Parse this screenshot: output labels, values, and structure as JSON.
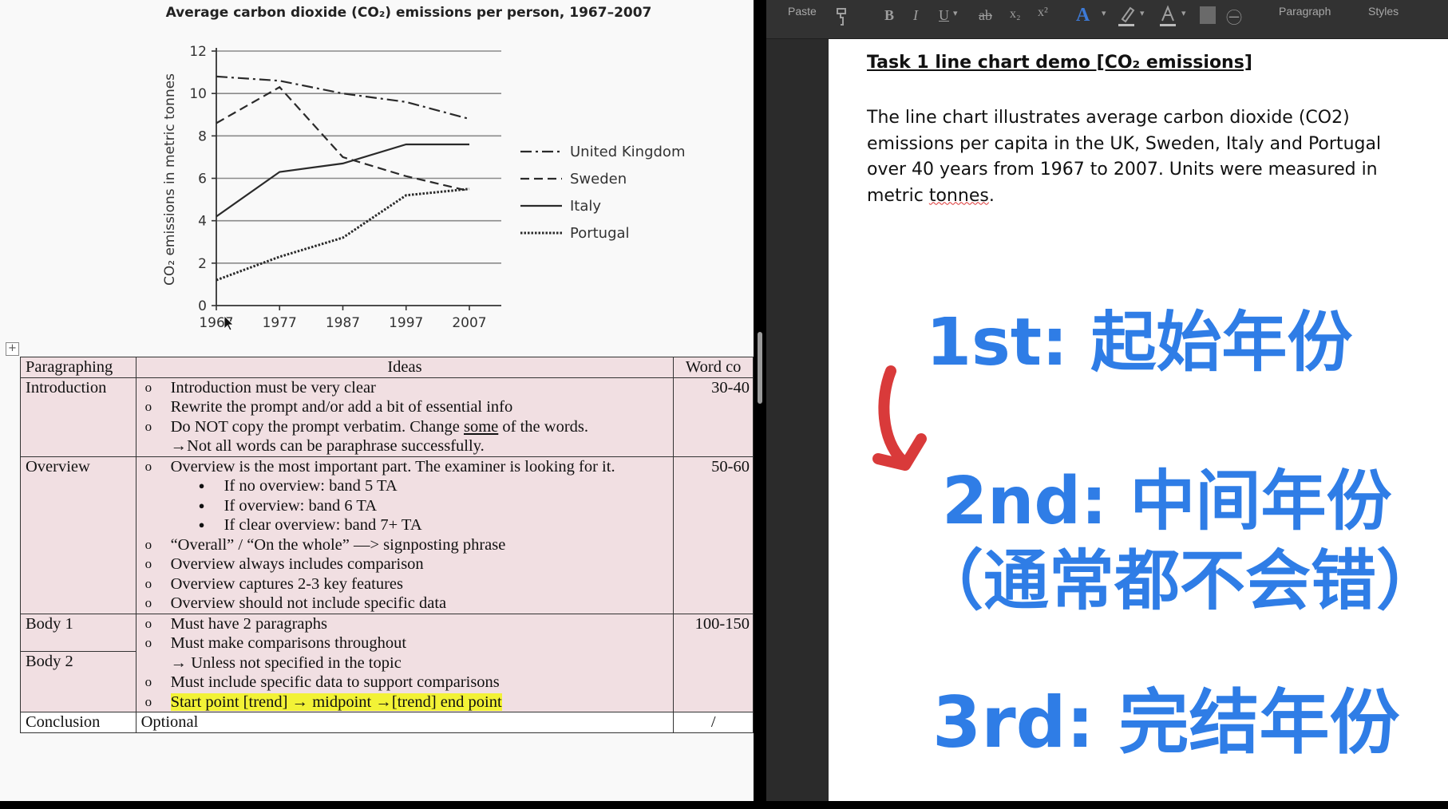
{
  "chart_data": {
    "type": "line",
    "title": "Average carbon dioxide (CO₂) emissions per person, 1967–2007",
    "ylabel": "CO₂ emissions in metric tonnes",
    "xlabel": "",
    "x": [
      1967,
      1977,
      1987,
      1997,
      2007
    ],
    "x_tick_labels": [
      "1967",
      "1977",
      "1987",
      "1997",
      "2007"
    ],
    "y_ticks": [
      0,
      2,
      4,
      6,
      8,
      10,
      12
    ],
    "ylim": [
      0,
      12
    ],
    "grid": "horizontal",
    "legend_position": "right",
    "series": [
      {
        "name": "United Kingdom",
        "style": "dash-dot",
        "values": [
          10.8,
          10.6,
          10.0,
          9.6,
          8.8
        ]
      },
      {
        "name": "Sweden",
        "style": "dashed",
        "values": [
          8.6,
          10.3,
          7.0,
          6.1,
          5.4
        ]
      },
      {
        "name": "Italy",
        "style": "solid",
        "values": [
          4.2,
          6.3,
          6.7,
          7.6,
          7.6
        ]
      },
      {
        "name": "Portugal",
        "style": "dotted",
        "values": [
          1.2,
          2.3,
          3.2,
          5.2,
          5.5
        ]
      }
    ]
  },
  "plan_table": {
    "headers": [
      "Paragraphing",
      "Ideas",
      "Word co"
    ],
    "introduction": {
      "label": "Introduction",
      "word_count": "30-40",
      "b1": "Introduction must be very clear",
      "b2": "Rewrite the prompt and/or add a bit of essential info",
      "b3_pre": "Do NOT copy the prompt verbatim. Change ",
      "b3_ul": "some",
      "b3_post": " of the words.",
      "b4": "→Not all words can be paraphrase successfully."
    },
    "overview": {
      "label": "Overview",
      "word_count": "50-60",
      "b1": "Overview is the most important part. The examiner is looking for it.",
      "d1": "If no overview: band 5 TA",
      "d2": "If overview: band 6 TA",
      "d3": "If clear overview: band 7+ TA",
      "b2": "“Overall” / “On the whole” —> signposting phrase",
      "b3": "Overview always includes comparison",
      "b4": "Overview captures 2-3 key features",
      "b5": "Overview should not include specific data"
    },
    "body": {
      "label1": "Body 1",
      "label2": "Body 2",
      "word_count": "100-150",
      "b1": "Must have 2 paragraphs",
      "b2": "Must make comparisons throughout",
      "b3": "→ Unless not specified in the topic",
      "b4": "Must include specific data to support comparisons",
      "b5": "Start point [trend] → midpoint →[trend] end point"
    },
    "conclusion": {
      "label": "Conclusion",
      "idea": "Optional",
      "word_count": "/"
    }
  },
  "toolbar": {
    "paste": "Paste",
    "bold": "B",
    "italic": "I",
    "underline": "U",
    "strike": "ab",
    "subscript": "x₂",
    "superscript": "x²",
    "font_color": "A",
    "paragraph": "Paragraph",
    "styles": "Styles"
  },
  "document": {
    "title": "Task 1 line chart demo [CO₂ emissions]",
    "body_pre": "The line chart illustrates average carbon dioxide (CO2) emissions per capita in the UK, Sweden, Italy and Portugal over 40 years from 1967 to 2007. Units were measured in metric ",
    "body_squiggle": "tonnes",
    "body_post": "."
  },
  "overlay": {
    "step1": "1st: 起始年份",
    "step2a": "2nd: 中间年份",
    "step2b": "（通常都不会错）",
    "step3": "3rd: 完结年份",
    "arrow_color": "#d93a3a",
    "text_color": "#2f7de6"
  }
}
